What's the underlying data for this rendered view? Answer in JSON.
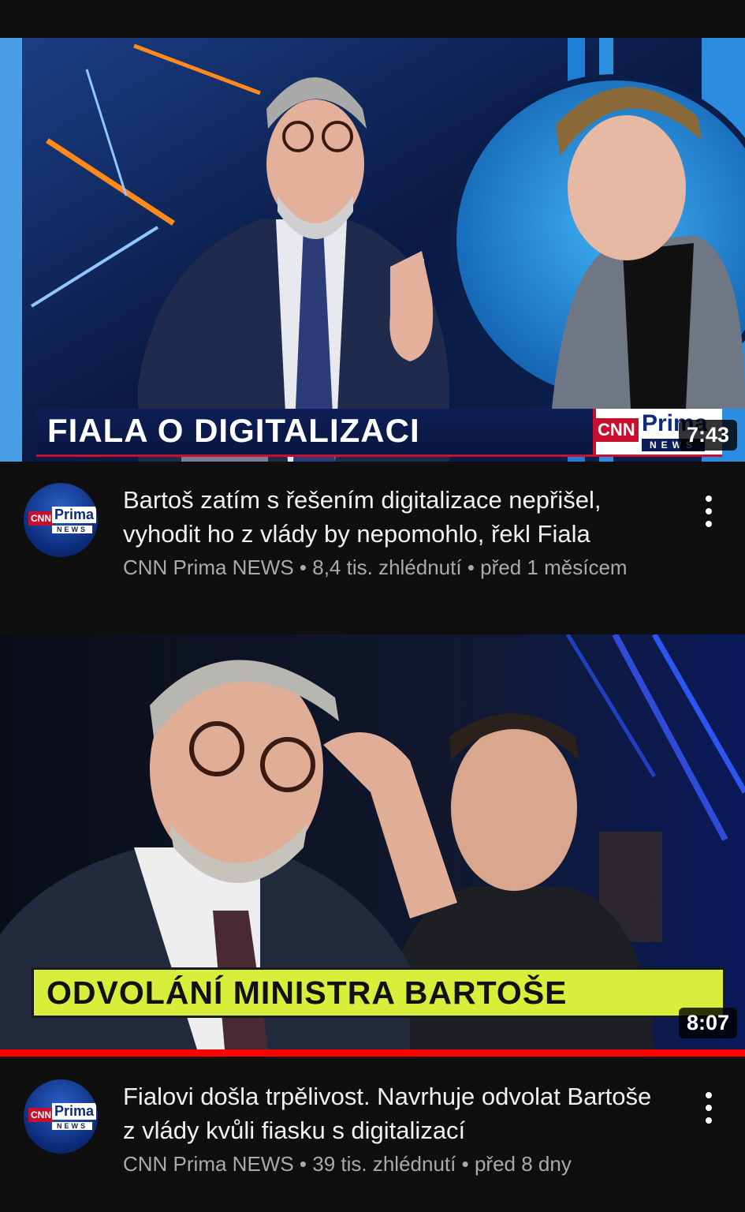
{
  "videos": [
    {
      "thumbnail_banner": "FIALA O DIGITALIZACI",
      "duration": "7:43",
      "title": "Bartoš zatím s řešením digitalizace nepřišel, vyhodit ho z vlády by nepomohlo, řekl Fiala",
      "channel": "CNN Prima NEWS",
      "views": "8,4 tis. zhlédnutí",
      "age": "před 1 měsícem"
    },
    {
      "thumbnail_banner": "ODVOLÁNÍ MINISTRA BARTOŠE",
      "duration": "8:07",
      "title": "Fialovi došla trpělivost. Navrhuje odvolat Bartoše z vlády kvůli fiasku s digitalizací",
      "channel": "CNN Prima NEWS",
      "views": "39 tis. zhlédnutí",
      "age": "před 8 dny"
    }
  ],
  "logo": {
    "cnn": "CNN",
    "prima": "Prima",
    "news": "NEWS"
  },
  "separator": "•",
  "colors": {
    "accent": "#ff0000",
    "banner_blue": "#0e1f57",
    "banner_yellow": "#d7ef3a"
  },
  "icons": {
    "more": "kebab-vertical-icon"
  },
  "watch_progress": 1.0
}
